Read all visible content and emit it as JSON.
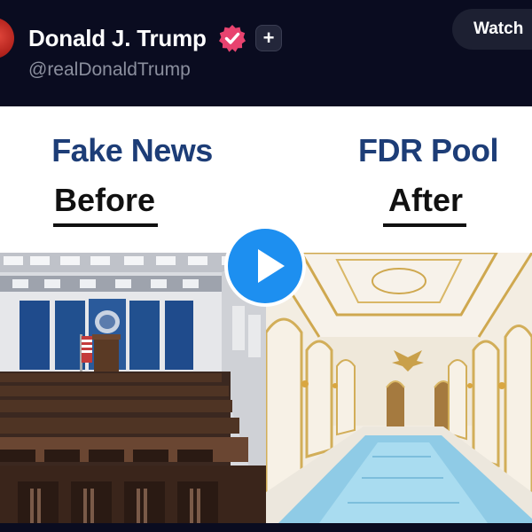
{
  "post": {
    "display_name": "Donald J. Trump",
    "handle": "@realDonaldTrump",
    "verified_icon": "verified-badge-icon",
    "subscribe_icon": "plus-icon",
    "subscribe_symbol": "+",
    "watch_label": "Watch"
  },
  "meme": {
    "left": {
      "title": "Fake News",
      "subtitle": "Before"
    },
    "right": {
      "title": "FDR Pool",
      "subtitle": "After"
    },
    "colors": {
      "title_blue": "#1d3d77",
      "play_blue": "#1d8ff0",
      "badge_pink": "#e8436f"
    }
  },
  "media": {
    "play_icon": "play-icon"
  }
}
